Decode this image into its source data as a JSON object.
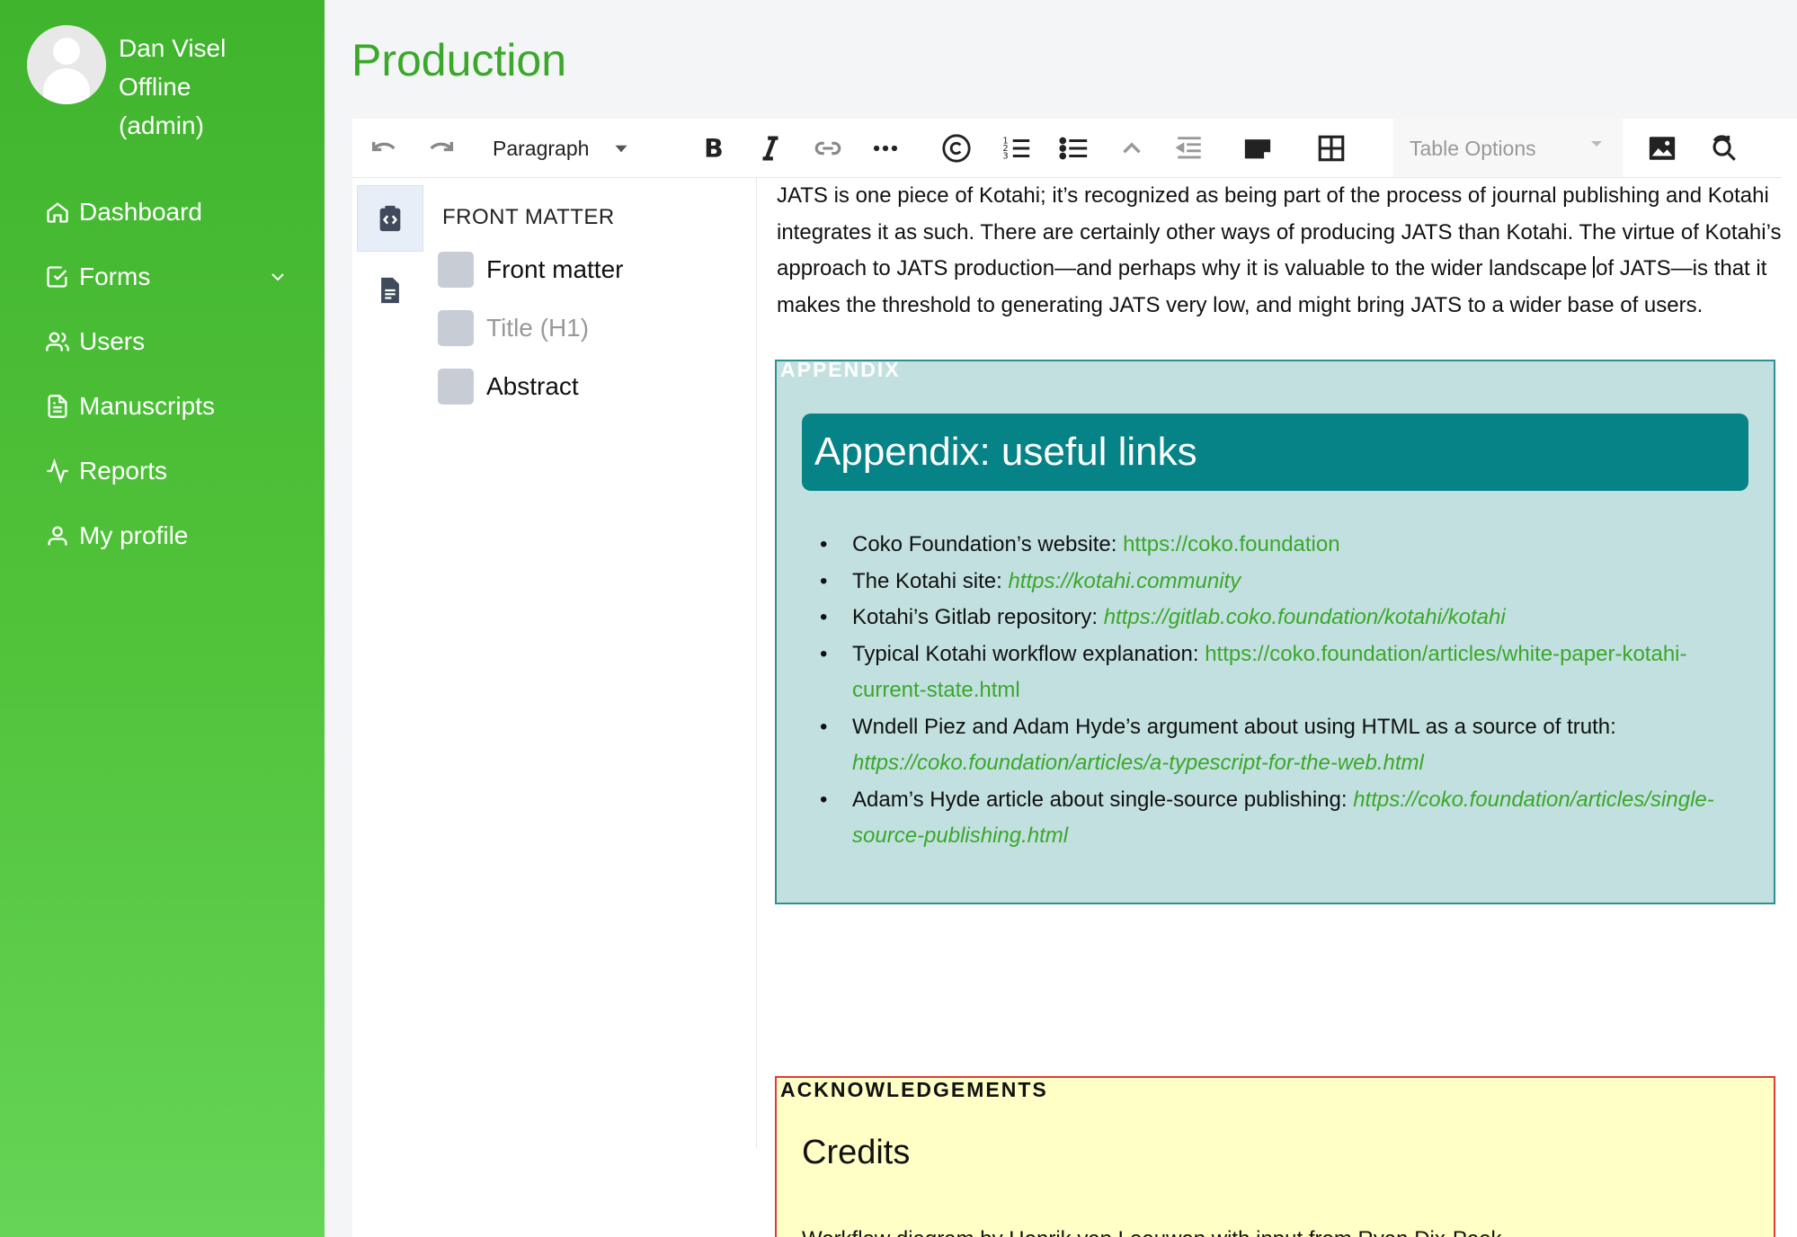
{
  "user": {
    "name": "Dan Visel",
    "status": "Offline",
    "role": "(admin)"
  },
  "nav": [
    {
      "label": "Dashboard",
      "icon": "home-icon"
    },
    {
      "label": "Forms",
      "icon": "check-square-icon",
      "has_chevron": true
    },
    {
      "label": "Users",
      "icon": "users-icon"
    },
    {
      "label": "Manuscripts",
      "icon": "file-icon"
    },
    {
      "label": "Reports",
      "icon": "activity-icon"
    },
    {
      "label": "My profile",
      "icon": "user-icon"
    }
  ],
  "page": {
    "title": "Production"
  },
  "toolbar": {
    "block_type": "Paragraph",
    "table_options": "Table Options"
  },
  "front_matter": {
    "title": "FRONT MATTER",
    "items": [
      {
        "label": "Front matter",
        "dim": false
      },
      {
        "label": "Title (H1)",
        "dim": true
      },
      {
        "label": "Abstract",
        "dim": false
      }
    ]
  },
  "content": {
    "intro_before_caret": "JATS is one piece of Kotahi; it’s recognized as being part of the process of journal publishing and Kotahi integrates it as such. There are certainly other ways of producing JATS than Kotahi. The virtue of Kotahi’s approach to JATS production—and perhaps why it is valuable to the wider landscape ",
    "intro_after_caret": "of JATS—is that it makes the threshold to generating JATS very low, and might bring JATS to a wider base of users.",
    "appendix": {
      "label": "APPENDIX",
      "heading": "Appendix: useful links",
      "links": [
        {
          "text": "Coko Foundation’s website: ",
          "url": "https://coko.foundation",
          "italic": false
        },
        {
          "text": "The Kotahi site: ",
          "url": "https://kotahi.community",
          "italic": true
        },
        {
          "text": "Kotahi’s Gitlab repository: ",
          "url": "https://gitlab.coko.foundation/kotahi/kotahi",
          "italic": true
        },
        {
          "text": "Typical Kotahi workflow explanation: ",
          "url": "https://coko.foundation/articles/white-paper-kotahi-current-state.html",
          "italic": false
        },
        {
          "text": "Wndell Piez and Adam Hyde’s argument about using HTML as a source of truth: ",
          "url": "https://coko.foundation/articles/a-typescript-for-the-web.html",
          "italic": true
        },
        {
          "text": "Adam’s Hyde article about single-source publishing: ",
          "url": "https://coko.foundation/articles/single-source-publishing.html",
          "italic": true
        }
      ]
    },
    "acknowledgements": {
      "label": "ACKNOWLEDGEMENTS",
      "heading": "Credits",
      "text": "Workflow diagram by Henrik van Leeuwen with input from Ryan Dix-Peek"
    }
  },
  "colors": {
    "sidebar": "#3fb42c",
    "accent": "#3aa829",
    "appendix_bg": "#c3e0e0",
    "appendix_head": "#058386",
    "ack_bg": "#ffffc6",
    "ack_border": "#e23a3a"
  }
}
